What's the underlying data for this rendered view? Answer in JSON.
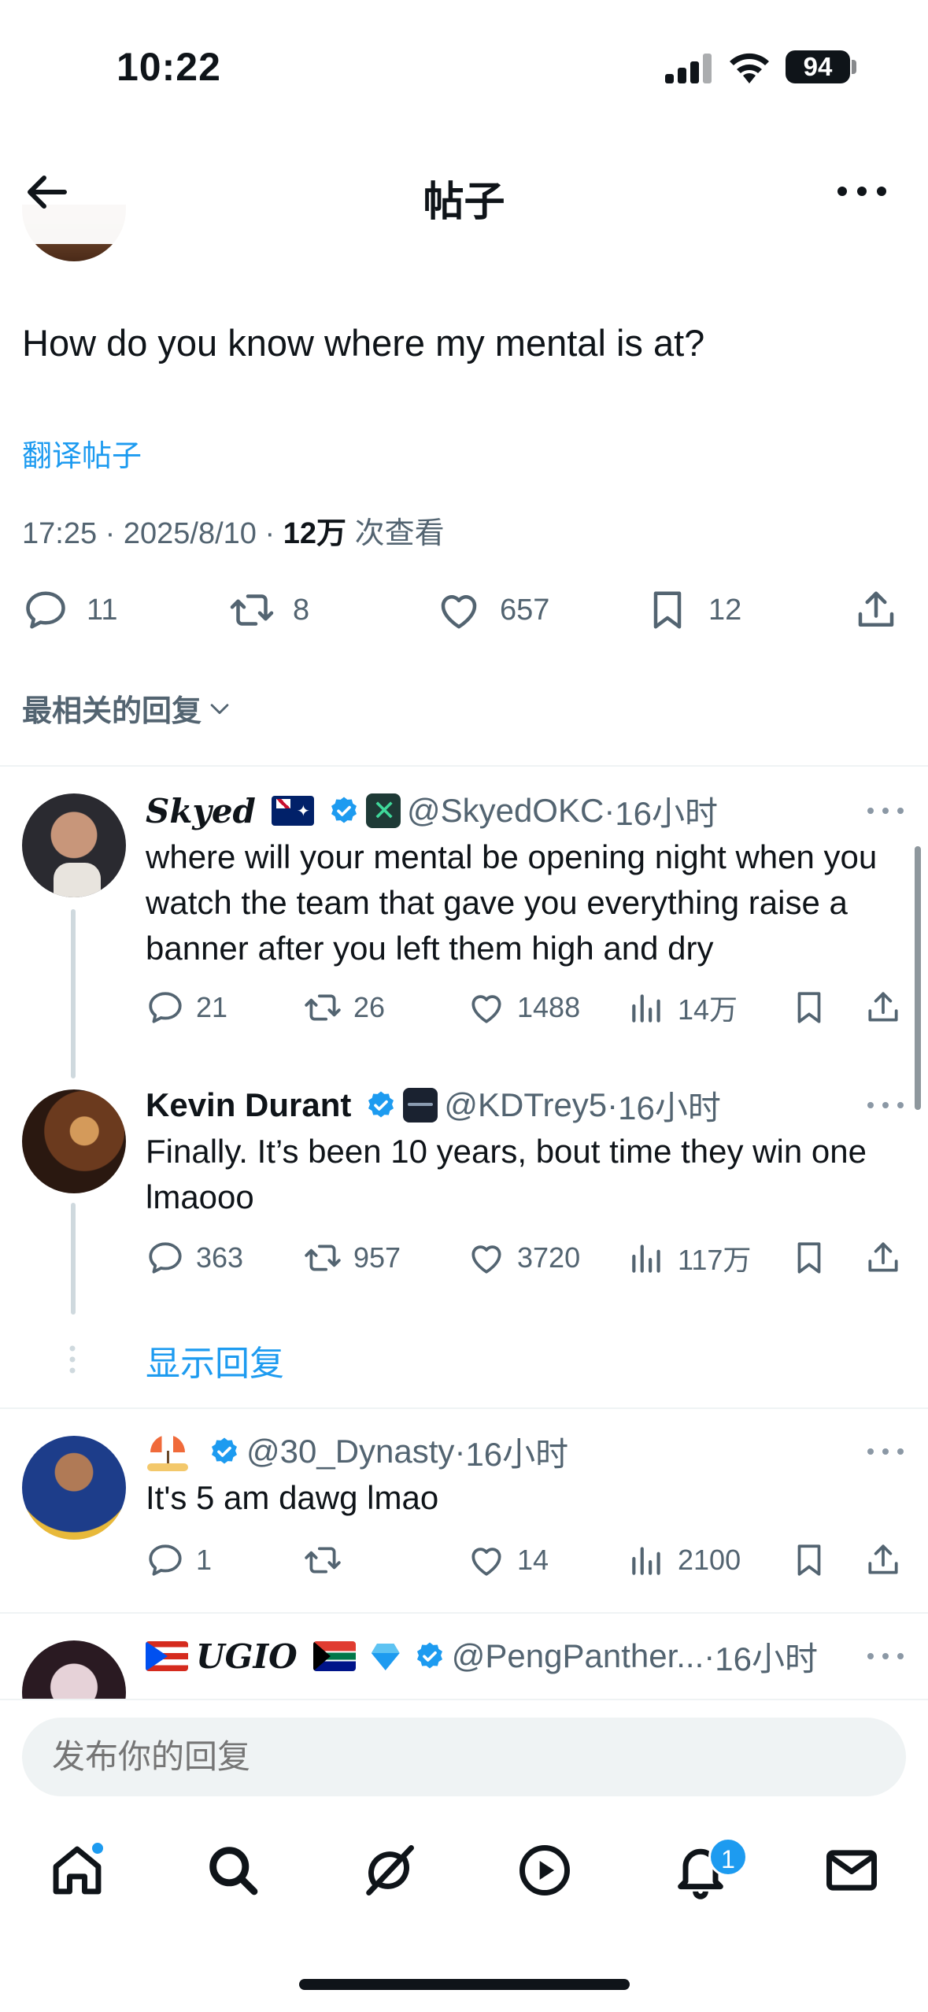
{
  "status_bar": {
    "time": "10:22",
    "battery": "94"
  },
  "header": {
    "title": "帖子"
  },
  "post": {
    "text": "How do you know where my mental is at?",
    "translate_label": "翻译帖子",
    "time": "17:25",
    "date": "2025/8/10",
    "views_count": "12万",
    "views_label": "次查看",
    "replies": "11",
    "reposts": "8",
    "likes": "657",
    "bookmarks": "12"
  },
  "sort": {
    "label": "最相关的回复"
  },
  "replies": [
    {
      "name": "Skyed",
      "handle": "@SkyedOKC",
      "time": "16小时",
      "text": "where will your mental be opening night when you watch the team that gave you everything raise a banner after you left them high and dry",
      "replies": "21",
      "reposts": "26",
      "likes": "1488",
      "views": "14万"
    },
    {
      "name": "Kevin Durant",
      "handle": "@KDTrey5",
      "time": "16小时",
      "text": "Finally. It’s been 10 years, bout time they win one lmaooo",
      "replies": "363",
      "reposts": "957",
      "likes": "3720",
      "views": "117万"
    },
    {
      "name": "",
      "handle": "@30_Dynasty",
      "time": "16小时",
      "text": "It's 5 am dawg lmao",
      "replies": "1",
      "reposts": "",
      "likes": "14",
      "views": "2100"
    },
    {
      "name": "𝑼𝑮𝑰𝑶",
      "handle": "@PengPanther...",
      "time": "16小时"
    }
  ],
  "show_replies_label": "显示回复",
  "composer": {
    "placeholder": "发布你的回复"
  },
  "tabbar": {
    "notifications_badge": "1"
  },
  "colors": {
    "accent": "#1d9bf0",
    "text": "#0f1419",
    "muted": "#536471"
  },
  "icons": [
    "back-arrow-icon",
    "more-icon",
    "reply-icon",
    "repost-icon",
    "like-icon",
    "bookmark-icon",
    "share-icon",
    "views-icon",
    "verified-badge-icon",
    "home-icon",
    "search-icon",
    "grok-icon",
    "video-icon",
    "bell-icon",
    "mail-icon"
  ]
}
